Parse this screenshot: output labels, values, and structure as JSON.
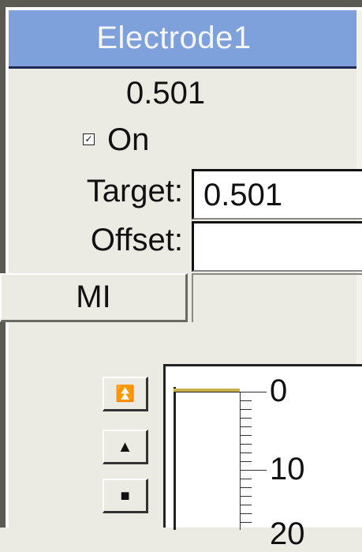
{
  "panel": {
    "title": "Electrode1",
    "value": "0.501",
    "on_checked": true,
    "on_label": "On",
    "checkbox_mark": "✓",
    "target_label": "Target:",
    "target_value": "0.501",
    "offset_label": "Offset:",
    "offset_value": "",
    "mi_label": "MI"
  },
  "buttons": {
    "top_glyph": "⏫",
    "up_glyph": "▲",
    "stop_glyph": "■"
  },
  "gauge": {
    "labels": [
      "0",
      "10",
      "20"
    ],
    "level_value": 0
  },
  "colors": {
    "title_bg": "#7ea0db",
    "panel_bg": "#ecebe3",
    "level_color": "#c9b14a"
  }
}
